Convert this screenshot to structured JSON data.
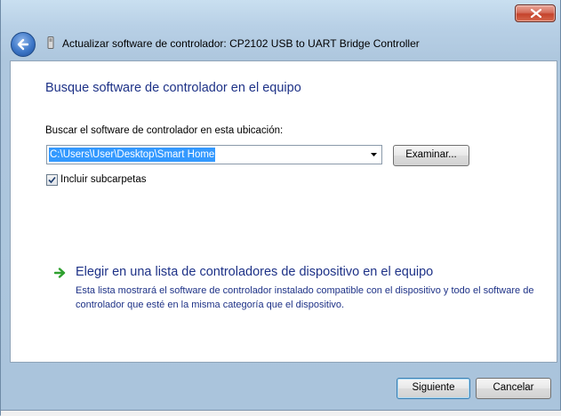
{
  "window": {
    "title": "Actualizar software de controlador: CP2102 USB to UART Bridge Controller"
  },
  "icons": {
    "close": "close-icon",
    "back": "back-arrow-icon",
    "device": "usb-device-icon",
    "dropdown": "chevron-down-icon",
    "check": "checkmark-icon",
    "link": "green-arrow-icon"
  },
  "main": {
    "heading": "Busque software de controlador en el equipo",
    "location_label": "Buscar el software de controlador en esta ubicación:",
    "location_value": "C:\\Users\\User\\Desktop\\Smart Home",
    "browse_label": "Examinar...",
    "include_subfolders_label": "Incluir subcarpetas",
    "include_subfolders_checked": true,
    "pick_title": "Elegir en una lista de controladores de dispositivo en el equipo",
    "pick_description": "Esta lista mostrará el software de controlador instalado compatible con el dispositivo y todo el software de controlador que esté en la misma categoría que el dispositivo."
  },
  "footer": {
    "next_label": "Siguiente",
    "cancel_label": "Cancelar"
  },
  "colors": {
    "heading": "#1e3287",
    "selection": "#3399ff",
    "link_arrow": "#2fa02f"
  }
}
